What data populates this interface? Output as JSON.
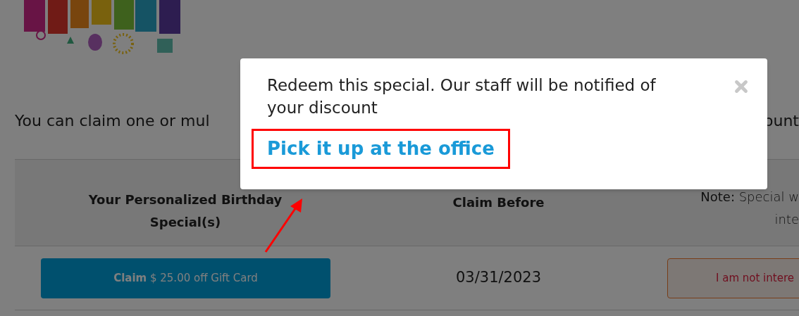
{
  "intro": {
    "start": "You can claim one or mul",
    "end": "ount"
  },
  "table": {
    "columns": [
      {
        "label": "Your Personalized Birthday Special(s)"
      },
      {
        "label": "Claim Before"
      },
      {
        "lines": [
          "**Note:** Special w",
          "inte"
        ]
      }
    ],
    "rows": [
      {
        "claim_button": "**Claim** $ 25.00 off Gift Card",
        "claim_before": "03/31/2023",
        "decline_button": "I am not intere"
      }
    ]
  },
  "modal": {
    "message": "Redeem this special. Our staff will be notified of your discount",
    "link": "Pick it up at the office",
    "highlighted": true
  }
}
